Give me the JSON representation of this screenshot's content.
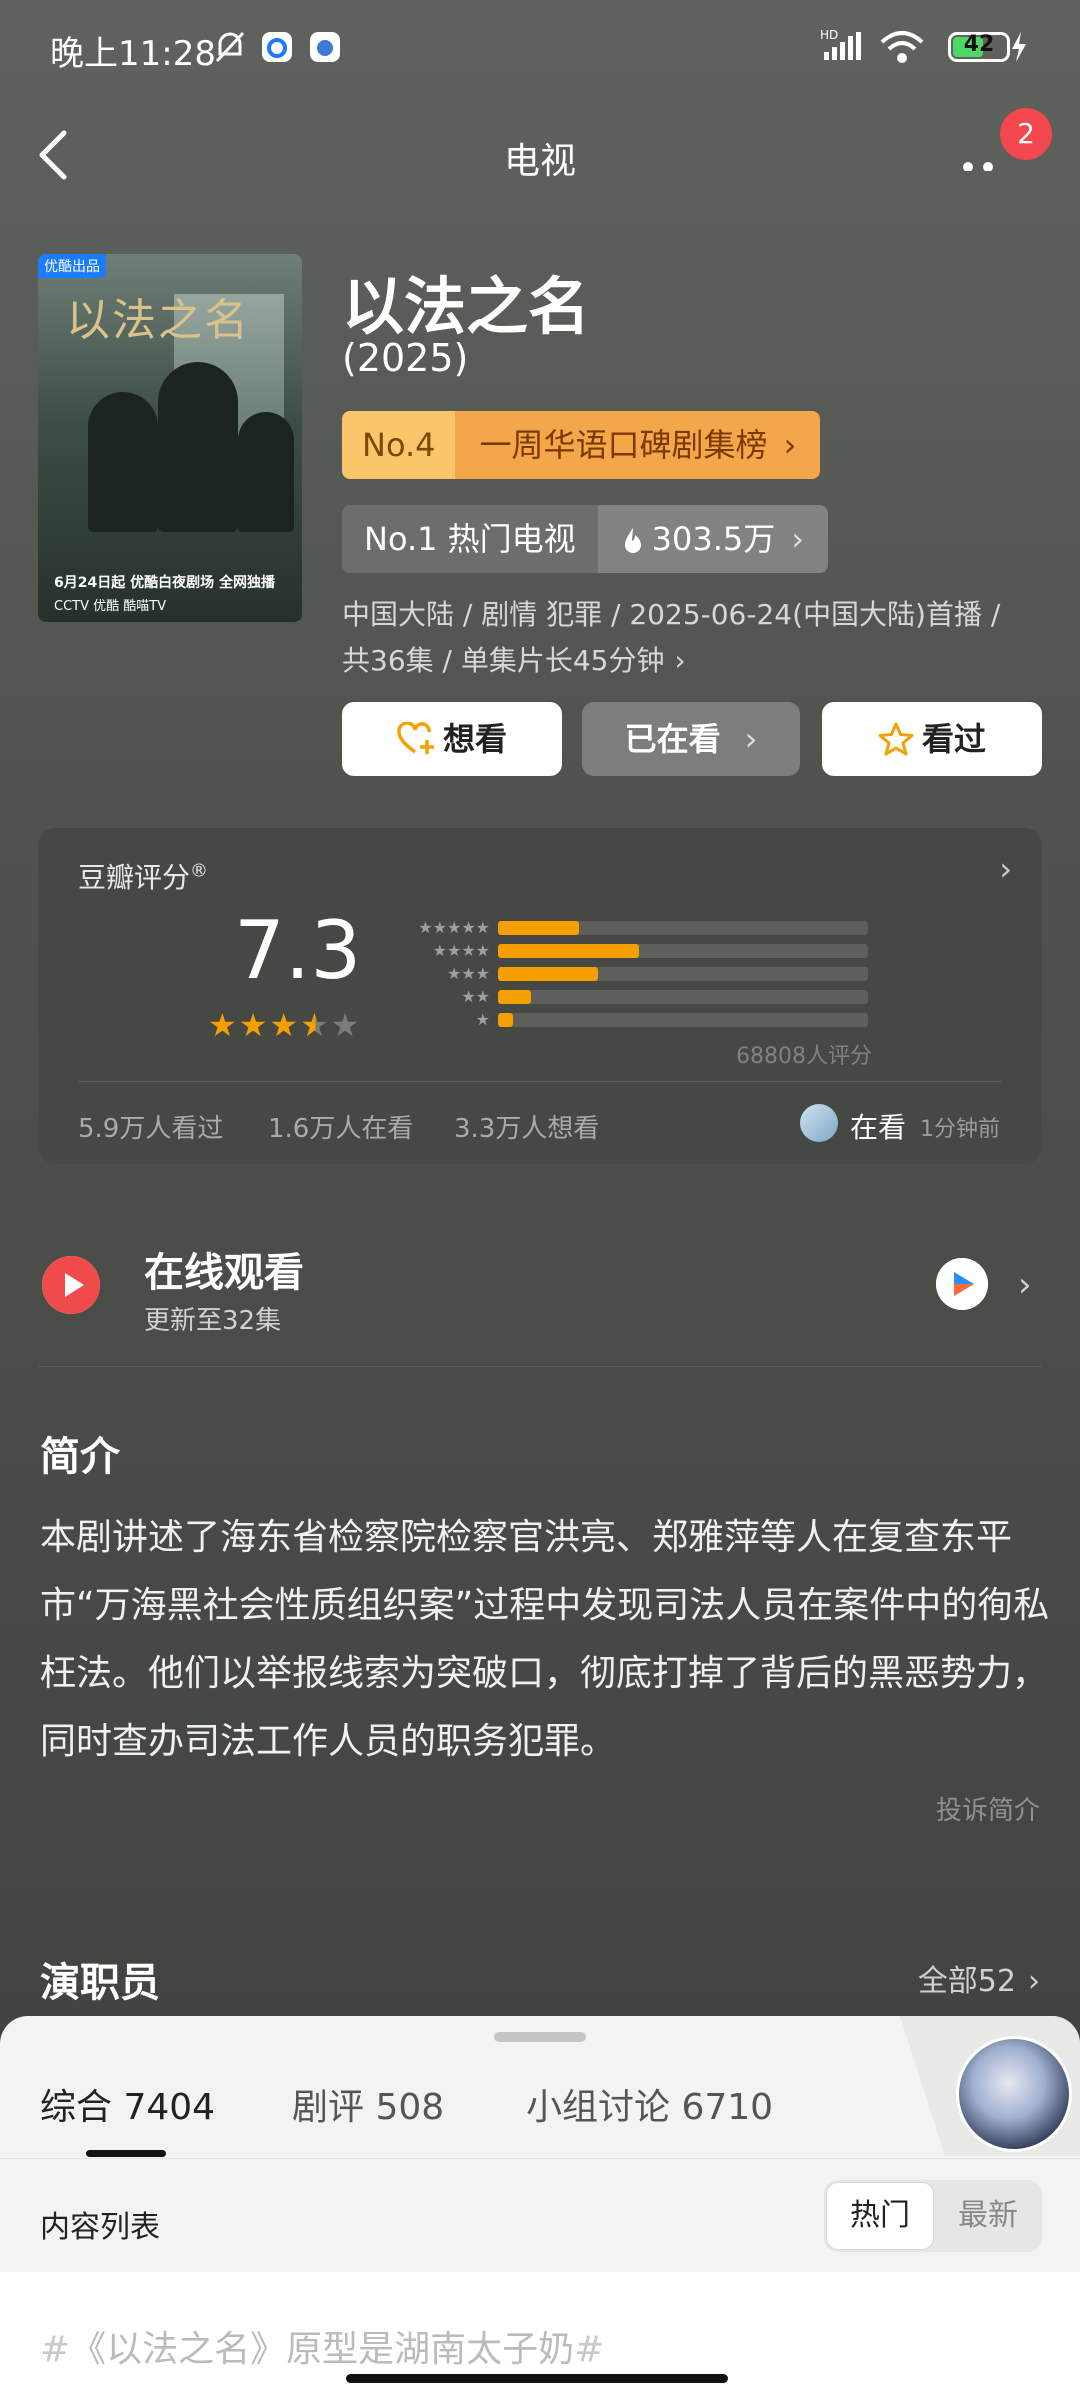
{
  "status_bar": {
    "time": "晚上11:28",
    "network": "HD",
    "battery": "42"
  },
  "nav": {
    "title": "电视",
    "notification_count": "2"
  },
  "poster": {
    "tag": "优酷出品",
    "title": "以法之名",
    "line1": "6月24日起 优酷白夜剧场 全网独播",
    "line2": "CCTV 优酷 酷喵TV"
  },
  "show": {
    "title": "以法之名",
    "year": "(2025)",
    "rank_no": "No.4",
    "rank_list": "一周华语口碑剧集榜",
    "hot_label": "No.1 热门电视",
    "hot_value": "303.5万",
    "meta_line1": "中国大陆 / 剧情 犯罪 / 2025-06-24(中国大陆)首播 /",
    "meta_line2": "共36集 / 单集片长45分钟"
  },
  "actions": {
    "want": "想看",
    "watching": "已在看",
    "seen": "看过"
  },
  "rating": {
    "label": "豆瓣评分",
    "registered": "®",
    "score": "7.3",
    "stars": 3.5,
    "count": "68808人评分",
    "distribution": [
      {
        "stars": "★★★★★",
        "percent": 22
      },
      {
        "stars": "★★★★",
        "percent": 38
      },
      {
        "stars": "★★★",
        "percent": 27
      },
      {
        "stars": "★★",
        "percent": 9
      },
      {
        "stars": "★",
        "percent": 4
      }
    ],
    "seen": "5.9万人看过",
    "watching": "1.6万人在看",
    "want": "3.3万人想看",
    "now_label": "在看",
    "now_time": "1分钟前"
  },
  "online": {
    "title": "在线观看",
    "subtitle": "更新至32集"
  },
  "intro": {
    "title": "简介",
    "text": "本剧讲述了海东省检察院检察官洪亮、郑雅萍等人在复查东平市“万海黑社会性质组织案”过程中发现司法人员在案件中的徇私枉法。他们以举报线索为突破口，彻底打掉了背后的黑恶势力，同时查办司法工作人员的职务犯罪。",
    "report": "投诉简介"
  },
  "cast": {
    "title": "演职员",
    "all": "全部52"
  },
  "sheet": {
    "tabs": [
      "综合 7404",
      "剧评 508",
      "小组讨论 6710"
    ],
    "list_label": "内容列表",
    "sort_hot": "热门",
    "sort_new": "最新",
    "post_hash": "#",
    "post_text": "《以法之名》原型是湖南太子奶",
    "post_hash_end": "#"
  }
}
